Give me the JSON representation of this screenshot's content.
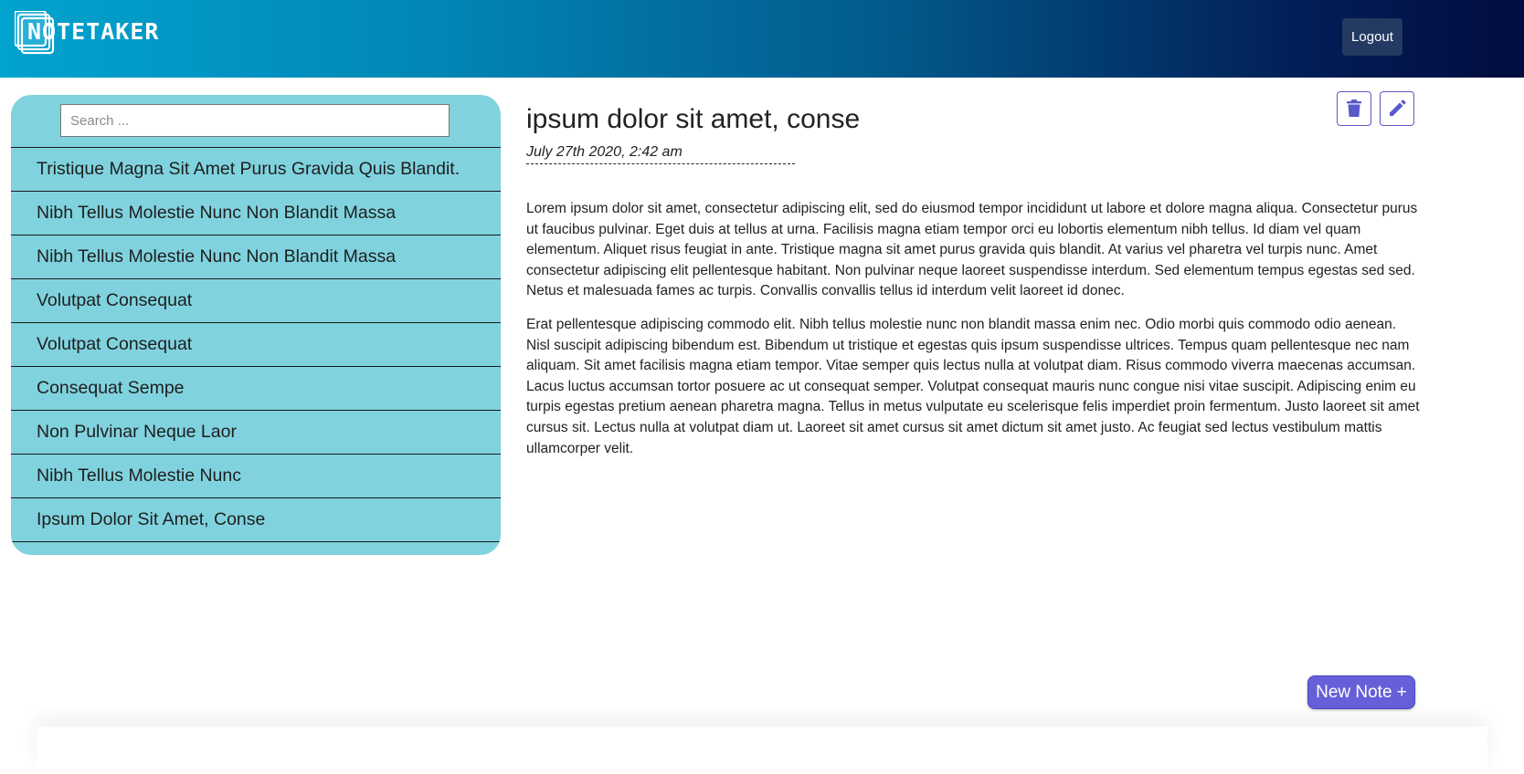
{
  "header": {
    "logo_text": "NOTETAKER",
    "logout_label": "Logout"
  },
  "sidebar": {
    "search_placeholder": "Search ...",
    "notes": [
      "Tristique Magna Sit Amet Purus Gravida Quis Blandit.",
      "Nibh Tellus Molestie Nunc Non Blandit Massa",
      "Nibh Tellus Molestie Nunc Non Blandit Massa",
      "Volutpat Consequat",
      "Volutpat Consequat",
      "Consequat Sempe",
      "Non Pulvinar Neque Laor",
      "Nibh Tellus Molestie Nunc",
      "Ipsum Dolor Sit Amet, Conse"
    ]
  },
  "note": {
    "title": "ipsum dolor sit amet, conse",
    "date": "July 27th 2020, 2:42 am",
    "paragraphs": [
      "Lorem ipsum dolor sit amet, consectetur adipiscing elit, sed do eiusmod tempor incididunt ut labore et dolore magna aliqua. Consectetur purus ut faucibus pulvinar. Eget duis at tellus at urna. Facilisis magna etiam tempor orci eu lobortis elementum nibh tellus. Id diam vel quam elementum. Aliquet risus feugiat in ante. Tristique magna sit amet purus gravida quis blandit. At varius vel pharetra vel turpis nunc. Amet consectetur adipiscing elit pellentesque habitant. Non pulvinar neque laoreet suspendisse interdum. Sed elementum tempus egestas sed sed. Netus et malesuada fames ac turpis. Convallis convallis tellus id interdum velit laoreet id donec.",
      "Erat pellentesque adipiscing commodo elit. Nibh tellus molestie nunc non blandit massa enim nec. Odio morbi quis commodo odio aenean. Nisl suscipit adipiscing bibendum est. Bibendum ut tristique et egestas quis ipsum suspendisse ultrices. Tempus quam pellentesque nec nam aliquam. Sit amet facilisis magna etiam tempor. Vitae semper quis lectus nulla at volutpat diam. Risus commodo viverra maecenas accumsan. Lacus luctus accumsan tortor posuere ac ut consequat semper. Volutpat consequat mauris nunc congue nisi vitae suscipit. Adipiscing enim eu turpis egestas pretium aenean pharetra magna. Tellus in metus vulputate eu scelerisque felis imperdiet proin fermentum. Justo laoreet sit amet cursus sit. Lectus nulla at volutpat diam ut. Laoreet sit amet cursus sit amet dictum sit amet justo. Ac feugiat sed lectus vestibulum mattis ullamcorper velit."
    ]
  },
  "actions": {
    "delete_icon": "trash-icon",
    "edit_icon": "pencil-icon",
    "new_note_label": "New Note +"
  },
  "colors": {
    "sidebar_bg": "#80d3de",
    "accent": "#5a59c9",
    "new_note_bg": "#6660d8",
    "logout_bg": "#243a63"
  }
}
